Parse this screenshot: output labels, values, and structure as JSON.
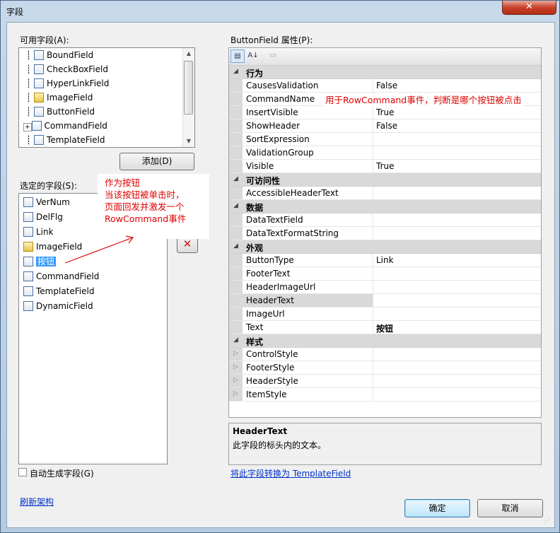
{
  "window": {
    "title": "字段",
    "close_glyph": "✕"
  },
  "available_fields": {
    "label": "可用字段(A):",
    "items": [
      {
        "label": "BoundField",
        "icon": "boundfield-icon"
      },
      {
        "label": "CheckBoxField",
        "icon": "checkbox-icon"
      },
      {
        "label": "HyperLinkField",
        "icon": "hyperlink-icon"
      },
      {
        "label": "ImageField",
        "icon": "image-icon"
      },
      {
        "label": "ButtonField",
        "icon": "button-icon"
      },
      {
        "label": "CommandField",
        "icon": "command-icon"
      },
      {
        "label": "TemplateField",
        "icon": "template-icon"
      }
    ],
    "add_button": "添加(D)"
  },
  "selected_fields": {
    "label": "选定的字段(S):",
    "items": [
      {
        "label": "VerNum",
        "icon": "boundfield-icon"
      },
      {
        "label": "DelFlg",
        "icon": "checkbox-icon"
      },
      {
        "label": "Link",
        "icon": "hyperlink-icon"
      },
      {
        "label": "ImageField",
        "icon": "image-icon"
      },
      {
        "label": "按钮",
        "icon": "button-icon",
        "selected": true
      },
      {
        "label": "CommandField",
        "icon": "command-icon"
      },
      {
        "label": "TemplateField",
        "icon": "template-icon"
      },
      {
        "label": "DynamicField",
        "icon": "dynamic-icon"
      }
    ],
    "delete_glyph": "✕"
  },
  "auto_generate": {
    "label": "自动生成字段(G)",
    "checked": false
  },
  "refresh_link": "刷新架构",
  "properties": {
    "label": "ButtonField 属性(P):",
    "toolbar": {
      "categorized_glyph": "▤",
      "alpha_glyph": "A↓",
      "pages_glyph": "▭"
    },
    "categories": [
      {
        "name": "行为",
        "rows": [
          {
            "name": "CausesValidation",
            "value": "False"
          },
          {
            "name": "CommandName",
            "value": ""
          },
          {
            "name": "InsertVisible",
            "value": "True"
          },
          {
            "name": "ShowHeader",
            "value": "False"
          },
          {
            "name": "SortExpression",
            "value": ""
          },
          {
            "name": "ValidationGroup",
            "value": ""
          },
          {
            "name": "Visible",
            "value": "True"
          }
        ]
      },
      {
        "name": "可访问性",
        "rows": [
          {
            "name": "AccessibleHeaderText",
            "value": ""
          }
        ]
      },
      {
        "name": "数据",
        "rows": [
          {
            "name": "DataTextField",
            "value": ""
          },
          {
            "name": "DataTextFormatString",
            "value": ""
          }
        ]
      },
      {
        "name": "外观",
        "rows": [
          {
            "name": "ButtonType",
            "value": "Link"
          },
          {
            "name": "FooterText",
            "value": ""
          },
          {
            "name": "HeaderImageUrl",
            "value": ""
          },
          {
            "name": "HeaderText",
            "value": ""
          },
          {
            "name": "ImageUrl",
            "value": ""
          },
          {
            "name": "Text",
            "value": "按钮"
          }
        ]
      },
      {
        "name": "样式",
        "rows": [
          {
            "name": "ControlStyle",
            "value": ""
          },
          {
            "name": "FooterStyle",
            "value": ""
          },
          {
            "name": "HeaderStyle",
            "value": ""
          },
          {
            "name": "ItemStyle",
            "value": ""
          }
        ]
      }
    ],
    "description": {
      "title": "HeaderText",
      "text": "此字段的标头内的文本。"
    },
    "convert_link": "将此字段转换为 TemplateField"
  },
  "buttons": {
    "ok": "确定",
    "cancel": "取消"
  },
  "annotations": {
    "commandname_note": "用于RowCommand事件，判断是哪个按钮被点击",
    "button_note": [
      "作为按钮",
      "当该按钮被单击时，",
      "页面回发并激发一个",
      "RowCommand事件"
    ],
    "color": "#e00000"
  }
}
